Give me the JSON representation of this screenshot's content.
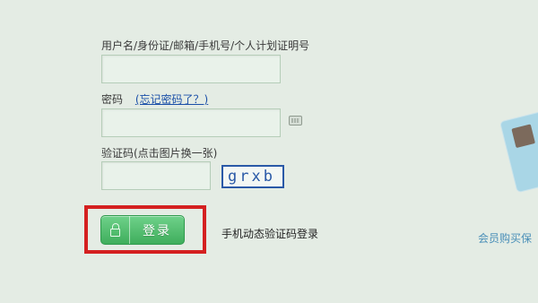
{
  "form": {
    "username_label": "用户名/身份证/邮箱/手机号/个人计划证明号",
    "username_value": "",
    "password_label": "密码",
    "forgot_password": "(忘记密码了？)",
    "password_value": "",
    "captcha_label": "验证码(点击图片换一张)",
    "captcha_value": "",
    "captcha_image_text": "grxb",
    "login_button": "登录",
    "sms_login": "手机动态验证码登录"
  },
  "side_banner": {
    "promo_text": "会员购买保"
  },
  "icons": {
    "keyboard": "keyboard-icon",
    "lock": "lock-icon"
  },
  "colors": {
    "background": "#e4ece4",
    "field_border": "#b5cdb8",
    "link": "#1a4fa8",
    "captcha": "#2a59a7",
    "button": "#3fae5c",
    "highlight": "#d42020",
    "promo": "#4a8fb8"
  }
}
